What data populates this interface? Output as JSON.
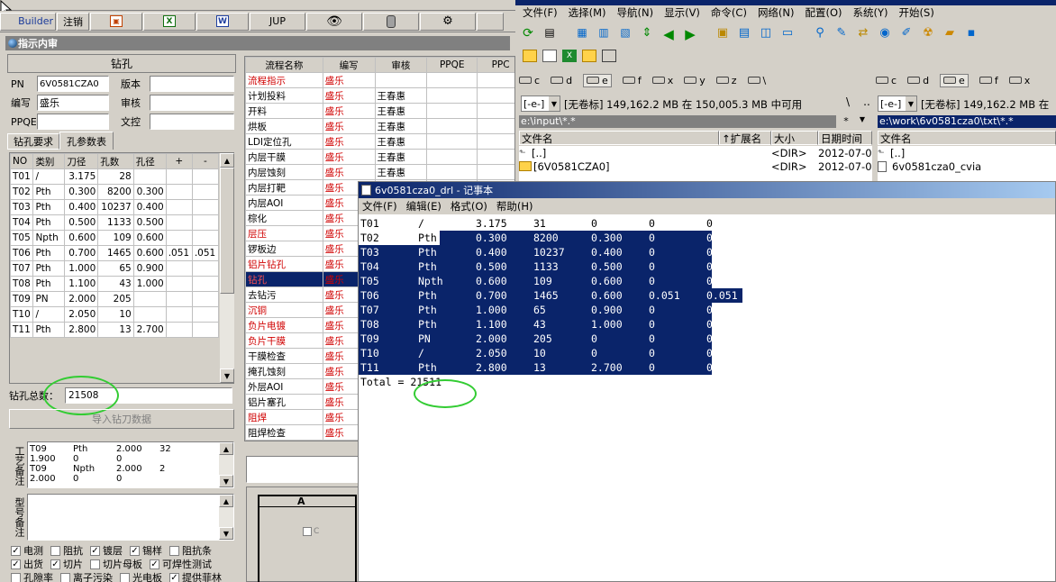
{
  "left": {
    "toolbar": {
      "builder": "Builder",
      "logout": "注销",
      "jup": "JUP"
    },
    "window_title": "指示内审",
    "drill_header": "钻孔",
    "info": {
      "pn_label": "PN",
      "pn_value": "6V0581CZA0",
      "version_label": "版本",
      "author_label": "编写",
      "author_value": "盛乐",
      "review_label": "审核",
      "ppqe_label": "PPQE",
      "proof_label": "文控"
    },
    "tabs": [
      "钻孔要求",
      "孔参数表"
    ],
    "table_headers": [
      "NO",
      "类别",
      "刀径",
      "孔数",
      "孔径",
      "+",
      "-"
    ],
    "table_rows": [
      [
        "T01",
        "/",
        "3.175",
        "28",
        "",
        "",
        ""
      ],
      [
        "T02",
        "Pth",
        "0.300",
        "8200",
        "0.300",
        "",
        ""
      ],
      [
        "T03",
        "Pth",
        "0.400",
        "10237",
        "0.400",
        "",
        ""
      ],
      [
        "T04",
        "Pth",
        "0.500",
        "1133",
        "0.500",
        "",
        ""
      ],
      [
        "T05",
        "Npth",
        "0.600",
        "109",
        "0.600",
        "",
        ""
      ],
      [
        "T06",
        "Pth",
        "0.700",
        "1465",
        "0.600",
        ".051",
        ".051"
      ],
      [
        "T07",
        "Pth",
        "1.000",
        "65",
        "0.900",
        "",
        ""
      ],
      [
        "T08",
        "Pth",
        "1.100",
        "43",
        "1.000",
        "",
        ""
      ],
      [
        "T09",
        "PN",
        "2.000",
        "205",
        "",
        "",
        ""
      ],
      [
        "T10",
        "/",
        "2.050",
        "10",
        "",
        "",
        ""
      ],
      [
        "T11",
        "Pth",
        "2.800",
        "13",
        "2.700",
        "",
        ""
      ]
    ],
    "total_label": "钻孔总数：",
    "total_value": "21508",
    "import_button": "导入钻刀数据",
    "process_note_label": "工艺备注",
    "process_notes": [
      [
        "T09",
        "Pth",
        "2.000",
        "32"
      ],
      [
        "1.900",
        "0",
        "0",
        ""
      ],
      [
        "T09",
        "Npth",
        "2.000",
        "2"
      ],
      [
        "2.000",
        "0",
        "0",
        ""
      ]
    ],
    "model_note_label": "型号备注",
    "checkboxes_row1": [
      {
        "label": "电测",
        "checked": true
      },
      {
        "label": "阻抗",
        "checked": false
      },
      {
        "label": "镀层",
        "checked": true
      },
      {
        "label": "锡样",
        "checked": true
      },
      {
        "label": "阻抗条",
        "checked": false
      }
    ],
    "checkboxes_row2": [
      {
        "label": "出货",
        "checked": true
      },
      {
        "label": "切片",
        "checked": true
      },
      {
        "label": "切片母板",
        "checked": false
      },
      {
        "label": "可焊性测试",
        "checked": true
      }
    ],
    "checkboxes_row3": [
      {
        "label": "孔隙率",
        "checked": false
      },
      {
        "label": "离子污染",
        "checked": false
      },
      {
        "label": "光电板",
        "checked": false
      },
      {
        "label": "提供菲林",
        "checked": true
      }
    ],
    "flow_headers": [
      "流程名称",
      "编写",
      "审核",
      "PPQE",
      "PPC"
    ],
    "flow_rows": [
      {
        "name": "流程指示",
        "author": "盛乐",
        "reviewer": "",
        "red": true,
        "selected": false
      },
      {
        "name": "计划投料",
        "author": "盛乐",
        "reviewer": "王春惠",
        "red": false,
        "selected": false
      },
      {
        "name": "开料",
        "author": "盛乐",
        "reviewer": "王春惠",
        "red": false,
        "selected": false
      },
      {
        "name": "烘板",
        "author": "盛乐",
        "reviewer": "王春惠",
        "red": false,
        "selected": false
      },
      {
        "name": "LDI定位孔",
        "author": "盛乐",
        "reviewer": "王春惠",
        "red": false,
        "selected": false
      },
      {
        "name": "内层干膜",
        "author": "盛乐",
        "reviewer": "王春惠",
        "red": false,
        "selected": false
      },
      {
        "name": "内层蚀刻",
        "author": "盛乐",
        "reviewer": "王春惠",
        "red": false,
        "selected": false
      },
      {
        "name": "内层打靶",
        "author": "盛乐",
        "reviewer": "",
        "red": false,
        "selected": false
      },
      {
        "name": "内层AOI",
        "author": "盛乐",
        "reviewer": "",
        "red": false,
        "selected": false
      },
      {
        "name": "棕化",
        "author": "盛乐",
        "reviewer": "",
        "red": false,
        "selected": false
      },
      {
        "name": "层压",
        "author": "盛乐",
        "reviewer": "",
        "red": true,
        "selected": false
      },
      {
        "name": "锣板边",
        "author": "盛乐",
        "reviewer": "",
        "red": false,
        "selected": false
      },
      {
        "name": "铝片钻孔",
        "author": "盛乐",
        "reviewer": "",
        "red": true,
        "selected": false
      },
      {
        "name": "钻孔",
        "author": "盛乐",
        "reviewer": "",
        "red": true,
        "selected": true
      },
      {
        "name": "去钻污",
        "author": "盛乐",
        "reviewer": "",
        "red": false,
        "selected": false
      },
      {
        "name": "沉铜",
        "author": "盛乐",
        "reviewer": "",
        "red": true,
        "selected": false
      },
      {
        "name": "负片电镀",
        "author": "盛乐",
        "reviewer": "",
        "red": true,
        "selected": false
      },
      {
        "name": "负片干膜",
        "author": "盛乐",
        "reviewer": "",
        "red": true,
        "selected": false
      },
      {
        "name": "干膜检查",
        "author": "盛乐",
        "reviewer": "",
        "red": false,
        "selected": false
      },
      {
        "name": "掩孔蚀刻",
        "author": "盛乐",
        "reviewer": "",
        "red": false,
        "selected": false
      },
      {
        "name": "外层AOI",
        "author": "盛乐",
        "reviewer": "",
        "red": false,
        "selected": false
      },
      {
        "name": "铝片塞孔",
        "author": "盛乐",
        "reviewer": "",
        "red": false,
        "selected": false
      },
      {
        "name": "阻焊",
        "author": "盛乐",
        "reviewer": "",
        "red": true,
        "selected": false
      },
      {
        "name": "阻焊检查",
        "author": "盛乐",
        "reviewer": "",
        "red": false,
        "selected": false
      }
    ],
    "drawing_label": "A",
    "drawing_checkbox": "C"
  },
  "right": {
    "menu": [
      "文件(F)",
      "选择(M)",
      "导航(N)",
      "显示(V)",
      "命令(C)",
      "网络(N)",
      "配置(O)",
      "系统(Y)",
      "开始(S)"
    ],
    "drives_left": [
      "c",
      "d",
      "e",
      "f",
      "x",
      "y",
      "z",
      "\\"
    ],
    "drives_right": [
      "c",
      "d",
      "e",
      "f",
      "x"
    ],
    "drive_select_left": "[-e-]",
    "drive_info_left": "[无卷标]  149,162.2 MB 在 150,005.3 MB 中可用",
    "drive_select_right": "[-e-]",
    "drive_info_right": "[无卷标]  149,162.2 MB 在",
    "path_left": "e:\\input\\*.*",
    "path_right": "e:\\work\\6v0581cza0\\txt\\*.*",
    "nav_root": "\\",
    "nav_up": "..",
    "star": "*",
    "cols_left": [
      "文件名",
      "↑扩展名",
      "大小",
      "日期时间"
    ],
    "cols_right": [
      "文件名"
    ],
    "files_left": [
      {
        "name": "[..]",
        "ext": "",
        "size": "<DIR>",
        "date": "2012-07-0"
      },
      {
        "name": "[6V0581CZA0]",
        "ext": "",
        "size": "<DIR>",
        "date": "2012-07-0"
      }
    ],
    "files_right": [
      "[..]",
      "6v0581cza0_cvia"
    ]
  },
  "notepad": {
    "title": "6v0581cza0_drl - 记事本",
    "menu": [
      "文件(F)",
      "编辑(E)",
      "格式(O)",
      "帮助(H)"
    ],
    "rows": [
      [
        "T01",
        "/",
        "3.175",
        "31",
        "0",
        "0",
        "0"
      ],
      [
        "T02",
        "Pth",
        "0.300",
        "8200",
        "0.300",
        "0",
        "0"
      ],
      [
        "T03",
        "Pth",
        "0.400",
        "10237",
        "0.400",
        "0",
        "0"
      ],
      [
        "T04",
        "Pth",
        "0.500",
        "1133",
        "0.500",
        "0",
        "0"
      ],
      [
        "T05",
        "Npth",
        "0.600",
        "109",
        "0.600",
        "0",
        "0"
      ],
      [
        "T06",
        "Pth",
        "0.700",
        "1465",
        "0.600",
        "0.051",
        "0.051"
      ],
      [
        "T07",
        "Pth",
        "1.000",
        "65",
        "0.900",
        "0",
        "0"
      ],
      [
        "T08",
        "Pth",
        "1.100",
        "43",
        "1.000",
        "0",
        "0"
      ],
      [
        "T09",
        "PN",
        "2.000",
        "205",
        "0",
        "0",
        "0"
      ],
      [
        "T10",
        "/",
        "2.050",
        "10",
        "0",
        "0",
        "0"
      ],
      [
        "T11",
        "Pth",
        "2.800",
        "13",
        "2.700",
        "0",
        "0"
      ]
    ],
    "total_line": "Total = 21511"
  }
}
